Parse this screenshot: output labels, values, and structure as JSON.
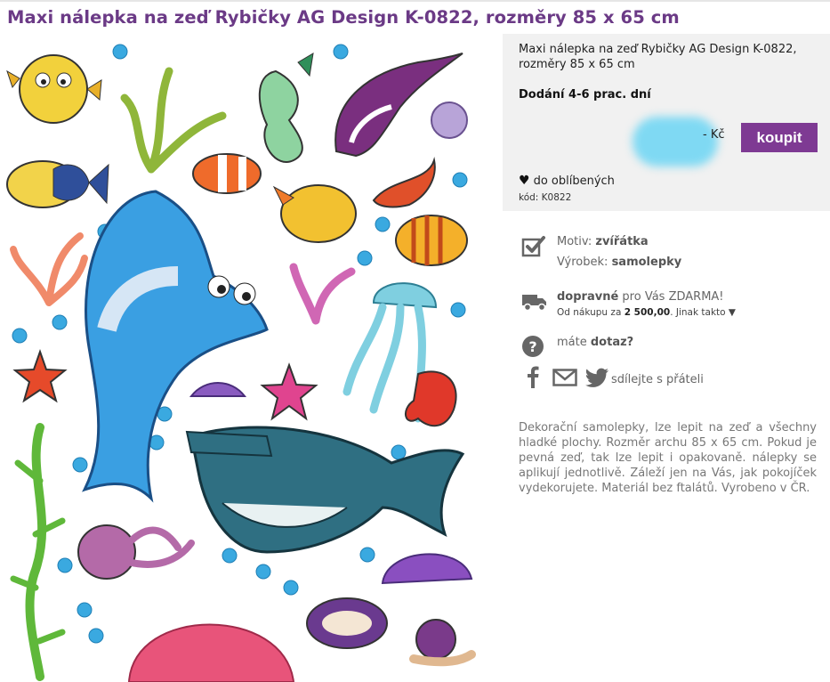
{
  "page": {
    "title": "Maxi nálepka na zeď Rybičky AG Design K-0822, rozměry 85 x 65 cm"
  },
  "buy_box": {
    "product_name": "Maxi nálepka na zeď Rybičky AG Design K-0822, rozměry 85 x 65 cm",
    "delivery": "Dodání 4-6 prac. dní",
    "price_currency": "- Kč",
    "buy_label": "koupit",
    "favorites_label": "do oblíbených",
    "code_label": "kód: K0822"
  },
  "info": {
    "motif_label": "Motiv:",
    "motif_value": "zvířátka",
    "product_label": "Výrobek:",
    "product_value": "samolepky",
    "shipping_bold": "dopravné",
    "shipping_text": "pro Vás ZDARMA!",
    "shipping_note_prefix": "Od nákupu za",
    "shipping_note_amount": "2 500,00",
    "shipping_note_suffix": ". Jinak takto ▼",
    "question_prefix": "máte",
    "question_bold": "dotaz?",
    "share_label": "sdílejte s přáteli"
  },
  "description": "Dekorační samolepky, lze lepit na zeď a všechny hladké plochy. Rozměr archu 85 x 65 cm. Pokud je pevná zeď, tak lze lepit i opakovaně. nálepky se aplikují jednotlivě. Záleží jen na Vás, jak pokojíček vydekorujete. Materiál bez ftalátů. Vyrobeno v ČR.",
  "icons": {
    "checkbox": "check-icon",
    "truck": "truck-icon",
    "question": "question-icon",
    "facebook": "facebook-icon",
    "email": "email-icon",
    "twitter": "twitter-icon",
    "heart": "heart-icon"
  },
  "colors": {
    "title": "#6b3a86",
    "button": "#7e3a93",
    "buy_box_bg": "#f1f1f1"
  }
}
